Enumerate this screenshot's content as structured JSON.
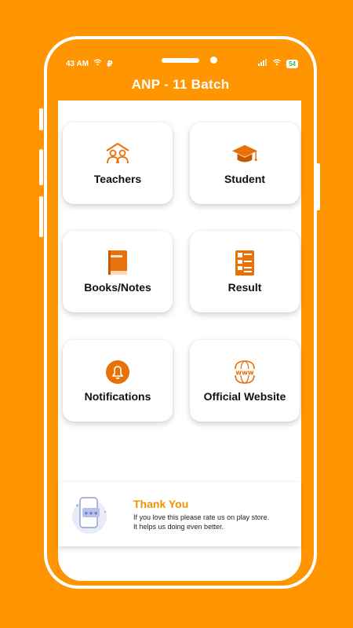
{
  "status_bar": {
    "time": "43 AM",
    "battery": "54"
  },
  "app": {
    "title": "ANP - 11 Batch"
  },
  "menu": {
    "items": [
      {
        "label": "Teachers",
        "icon": "teachers-icon"
      },
      {
        "label": "Student",
        "icon": "graduation-cap-icon"
      },
      {
        "label": "Books/Notes",
        "icon": "book-icon"
      },
      {
        "label": "Result",
        "icon": "result-sheet-icon"
      },
      {
        "label": "Notifications",
        "icon": "bell-icon"
      },
      {
        "label": "Official Website",
        "icon": "www-globe-icon"
      }
    ]
  },
  "banner": {
    "title": "Thank You",
    "line1": "If you love this please rate us on play store.",
    "line2": "It helps us doing even better."
  },
  "colors": {
    "accent": "#FF9500",
    "icon_orange": "#E8710A",
    "card_bg": "#FFFFFF"
  }
}
